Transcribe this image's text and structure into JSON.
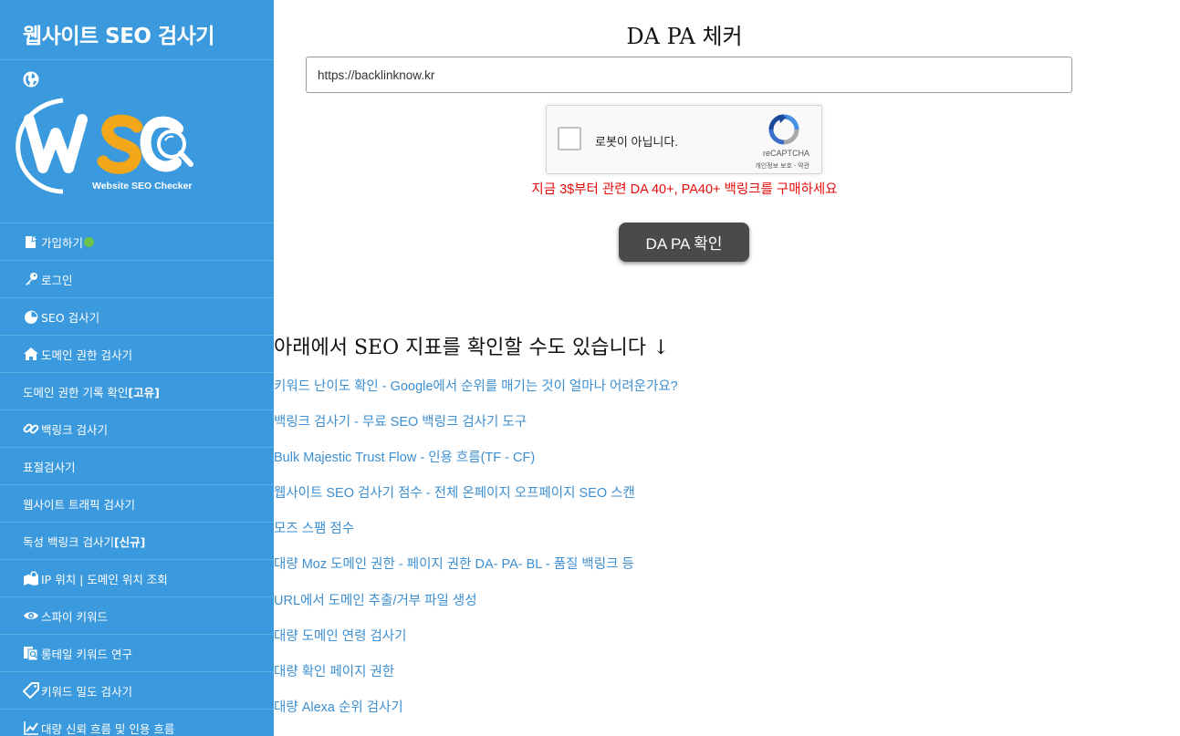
{
  "sidebar": {
    "title": "웹사이트 SEO 검사기",
    "logo_tagline": "Website SEO Checker",
    "items": [
      {
        "label": "가입하기",
        "icon": "signup-icon",
        "dot": true
      },
      {
        "label": "로그인",
        "icon": "key-icon"
      },
      {
        "label": "SEO 검사기",
        "icon": "pie-chart-icon"
      },
      {
        "label": "도메인 권한 검사기",
        "icon": "home-icon"
      },
      {
        "label": "도메인 권한 기록 확인 ",
        "suffix": "[고유]"
      },
      {
        "label": "백링크 검사기",
        "icon": "link-icon"
      },
      {
        "label": "표절검사기"
      },
      {
        "label": "웹사이트 트래픽 검사기"
      },
      {
        "label": "독성 백링크 검사기 ",
        "suffix": "[신규]"
      },
      {
        "label": "IP 위치 | 도메인 위치 조회",
        "icon": "map-pin-icon"
      },
      {
        "label": "스파이 키워드",
        "icon": "eye-icon"
      },
      {
        "label": "롱테일 키워드 연구",
        "icon": "search-doc-icon"
      },
      {
        "label": "키워드 밀도 검사기",
        "icon": "tag-icon"
      },
      {
        "label": "대량 신뢰 흐름 및 인용 흐름",
        "icon": "line-chart-icon"
      }
    ]
  },
  "checker": {
    "title": "DA PA 체커",
    "url_value": "https://backlinknow.kr",
    "recaptcha_label": "로봇이 아닙니다.",
    "recaptcha_brand": "reCAPTCHA",
    "recaptcha_privacy": "개인정보 보호 - 약관",
    "promo": "지금 3$부터 관련 DA 40+, PA40+ 백링크를 구매하세요",
    "button_label": "DA PA 확인"
  },
  "related": {
    "heading": "아래에서 SEO 지표를 확인할 수도 있습니다 ↓",
    "links": [
      "키워드 난이도 확인 - Google에서 순위를 매기는 것이 얼마나 어려운가요?",
      "백링크 검사기 - 무료 SEO 백링크 검사기 도구",
      "Bulk Majestic Trust Flow - 인용 흐름(TF - CF)",
      "웹사이트 SEO 검사기 점수 - 전체 온페이지 오프페이지 SEO 스캔",
      "모즈 스팸 점수",
      "대량 Moz 도메인 권한 - 페이지 권한 DA- PA- BL - 품질 백링크 등",
      "URL에서 도메인 추출/거부 파일 생성",
      "대량 도메인 연령 검사기",
      "대량 확인 페이지 권한",
      "대량 Alexa 순위 검사기"
    ]
  },
  "colors": {
    "sidebar_bg": "#3b99dd",
    "promo_red": "#e40b0b",
    "link_blue": "#3d8fd1",
    "button_bg": "#4a4a4a"
  }
}
